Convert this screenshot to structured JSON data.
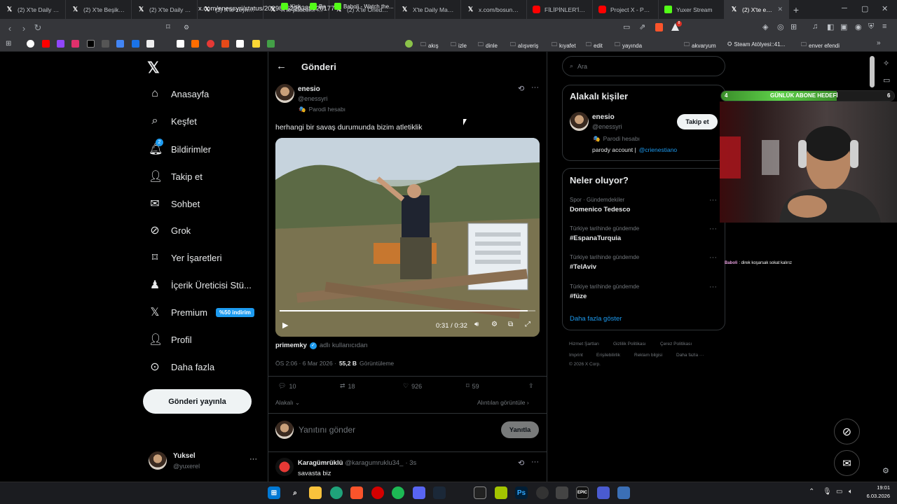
{
  "browser": {
    "tabs": [
      {
        "title": "(2) X'te Daily Mag",
        "favicon": "x"
      },
      {
        "title": "(2) X'te Beşiktaş J",
        "favicon": "x"
      },
      {
        "title": "(2) X'te Daily Mag",
        "favicon": "x"
      },
      {
        "title": "(2) X'te zeynep: \"",
        "favicon": "x"
      },
      {
        "title": "X'te platcom: \"xG",
        "favicon": "x"
      },
      {
        "title": "(2) X'te Onedio: \"",
        "favicon": "x"
      },
      {
        "title": "X'te Daily Magazi",
        "favicon": "x"
      },
      {
        "title": "x.com/bosunatik",
        "favicon": "x"
      },
      {
        "title": "FİLİPİNLER'İN ŞAŞ",
        "favicon": "youtube"
      },
      {
        "title": "Project X - Pursu",
        "favicon": "youtube"
      },
      {
        "title": "Yuxer Stream",
        "favicon": "kick"
      },
      {
        "title": "(2) X'te enes",
        "favicon": "x",
        "active": true
      }
    ],
    "new_tab": "+",
    "url": "x.com/enessyri/status/2029876220389626177",
    "bookmarks": [
      "akış",
      "izle",
      "dinle",
      "alışveriş",
      "kıyafet",
      "edit",
      "yayında",
      "akvaryum",
      "Steam Atölyesi::41...",
      "enver efendi"
    ],
    "bookmark_apps": [
      "Kick",
      "Ba",
      "Baboli - Watch the..."
    ]
  },
  "sidebar": {
    "items": [
      {
        "label": "Anasayfa",
        "icon": "home-icon"
      },
      {
        "label": "Keşfet",
        "icon": "search-icon"
      },
      {
        "label": "Bildirimler",
        "icon": "bell-icon",
        "badge": "2"
      },
      {
        "label": "Takip et",
        "icon": "add-person-icon"
      },
      {
        "label": "Sohbet",
        "icon": "mail-icon"
      },
      {
        "label": "Grok",
        "icon": "grok-icon"
      },
      {
        "label": "Yer İşaretleri",
        "icon": "bookmark-icon"
      },
      {
        "label": "İçerik Üreticisi Stü...",
        "icon": "creator-icon"
      },
      {
        "label": "Premium",
        "icon": "x-icon",
        "badge": "%50 indirim"
      },
      {
        "label": "Profil",
        "icon": "person-icon"
      },
      {
        "label": "Daha fazla",
        "icon": "more-icon"
      }
    ],
    "post_button": "Gönderi yayınla",
    "account": {
      "name": "Yuksel",
      "handle": "@yuxerel"
    }
  },
  "post": {
    "header_title": "Gönderi",
    "author_name": "enesio",
    "author_handle": "@enessyri",
    "parody_label": "Parodi hesabı",
    "text": "herhangi bir savaş durumunda bizim atletiklik",
    "video_time": "0:31 / 0:32",
    "video_progress": 0.97,
    "from_user": "primemky",
    "from_suffix": "adlı kullanıcıdan",
    "meta_time": "ÖS 2:06 · 6 Mar 2026 ·",
    "views_count": "55,2 B",
    "views_label": "Görüntüleme",
    "stats": {
      "replies": "10",
      "reposts": "18",
      "likes": "926",
      "bookmarks": "59"
    },
    "sort_label": "Alakalı",
    "quotes_label": "Alıntılan görüntüle",
    "reply_placeholder": "Yanıtını gönder",
    "reply_button": "Yanıtla"
  },
  "reply": {
    "name": "Karagümrüklü",
    "handle": "@karagumruklu34_",
    "time": "· 3s",
    "text": "savasta biz"
  },
  "right": {
    "search_placeholder": "Ara",
    "related_title": "Alakalı kişiler",
    "related_person": {
      "name": "enesio",
      "handle": "@enessyri",
      "parody": "Parodi hesabı",
      "bio_text": "parody account |",
      "bio_link": "@crienestiano",
      "follow_label": "Takip et"
    },
    "trends_title": "Neler oluyor?",
    "trends": [
      {
        "category": "Spor · Gündemdekiler",
        "name": "Domenico Tedesco"
      },
      {
        "category": "Türkiye tarihinde gündemde",
        "name": "#EspanaTurquia"
      },
      {
        "category": "Türkiye tarihinde gündemde",
        "name": "#TelAviv"
      },
      {
        "category": "Türkiye tarihinde gündemde",
        "name": "#füze"
      }
    ],
    "show_more": "Daha fazla göster",
    "footer_line1": [
      "Hizmet Şartları",
      "Gizlilik Politikası",
      "Çerez Politikası"
    ],
    "footer_line2": [
      "Imprint",
      "Erişilebilirlik",
      "Reklam bilgisi",
      "Daha fazla ···"
    ],
    "copyright": "© 2026 X Corp."
  },
  "overlay": {
    "goal_left": "4",
    "goal_label": "GÜNLÜK ABONE HEDEFİ",
    "goal_right": "6",
    "goal_progress": 0.6667,
    "chat_user": "Baboli",
    "chat_text": ": direk koşarsak sokat kalırız"
  },
  "taskbar": {
    "time": "19:01",
    "date": "6.03.2026"
  },
  "colors": {
    "accent": "#1d9bf0",
    "background": "#000000",
    "border": "#2f3336"
  }
}
